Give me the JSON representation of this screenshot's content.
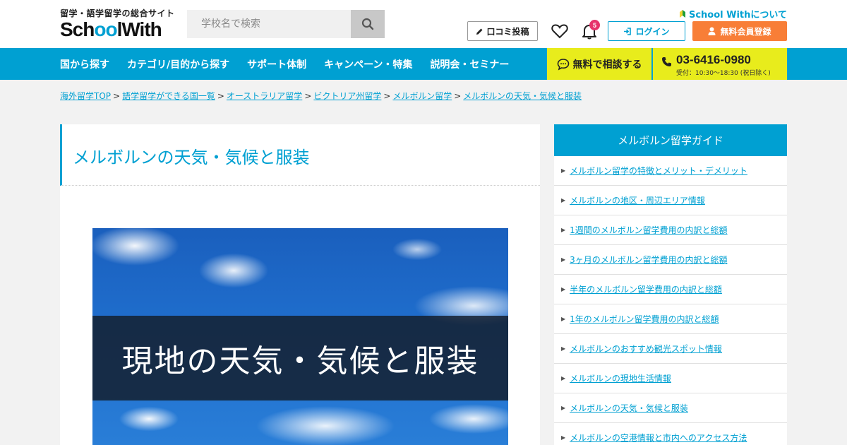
{
  "header": {
    "tagline": "留学・語学留学の総合サイト",
    "logo_text_a": "Sch",
    "logo_text_oo": "oo",
    "logo_text_b": "lWith",
    "search_placeholder": "学校名で検索",
    "about_link": "School Withについて",
    "review_button": "口コミ投稿",
    "notification_count": "5",
    "login_button": "ログイン",
    "register_button": "無料会員登録"
  },
  "nav": {
    "items": [
      {
        "label": "国から探す"
      },
      {
        "label": "カテゴリ/目的から探す"
      },
      {
        "label": "サポート体制"
      },
      {
        "label": "キャンペーン・特集"
      },
      {
        "label": "説明会・セミナー"
      }
    ],
    "consult_button": "無料で相談する",
    "phone": "03-6416-0980",
    "hours": "受付：10:30〜18:30 (祝日除く)"
  },
  "breadcrumb": [
    {
      "label": "海外留学TOP"
    },
    {
      "label": "語学留学ができる国一覧"
    },
    {
      "label": "オーストラリア留学"
    },
    {
      "label": "ビクトリア州留学"
    },
    {
      "label": "メルボルン留学"
    },
    {
      "label": "メルボルンの天気・気候と服装"
    }
  ],
  "breadcrumb_separator": ">",
  "main": {
    "title": "メルボルンの天気・気候と服装",
    "hero_text": "現地の天気・気候と服装"
  },
  "sidebar": {
    "title": "メルボルン留学ガイド",
    "items": [
      {
        "label": "メルボルン留学の特徴とメリット・デメリット"
      },
      {
        "label": "メルボルンの地区・周辺エリア情報"
      },
      {
        "label": "1週間のメルボルン留学費用の内訳と総額"
      },
      {
        "label": "3ヶ月のメルボルン留学費用の内訳と総額"
      },
      {
        "label": "半年のメルボルン留学費用の内訳と総額"
      },
      {
        "label": "1年のメルボルン留学費用の内訳と総額"
      },
      {
        "label": "メルボルンのおすすめ観光スポット情報"
      },
      {
        "label": "メルボルンの現地生活情報"
      },
      {
        "label": "メルボルンの天気・気候と服装"
      },
      {
        "label": "メルボルンの空港情報と市内へのアクセス方法"
      }
    ]
  },
  "colors": {
    "brand_blue": "#00a0d2",
    "accent_yellow": "#e8ec1c",
    "register_orange": "#f87e37",
    "badge_pink": "#e6336b"
  }
}
